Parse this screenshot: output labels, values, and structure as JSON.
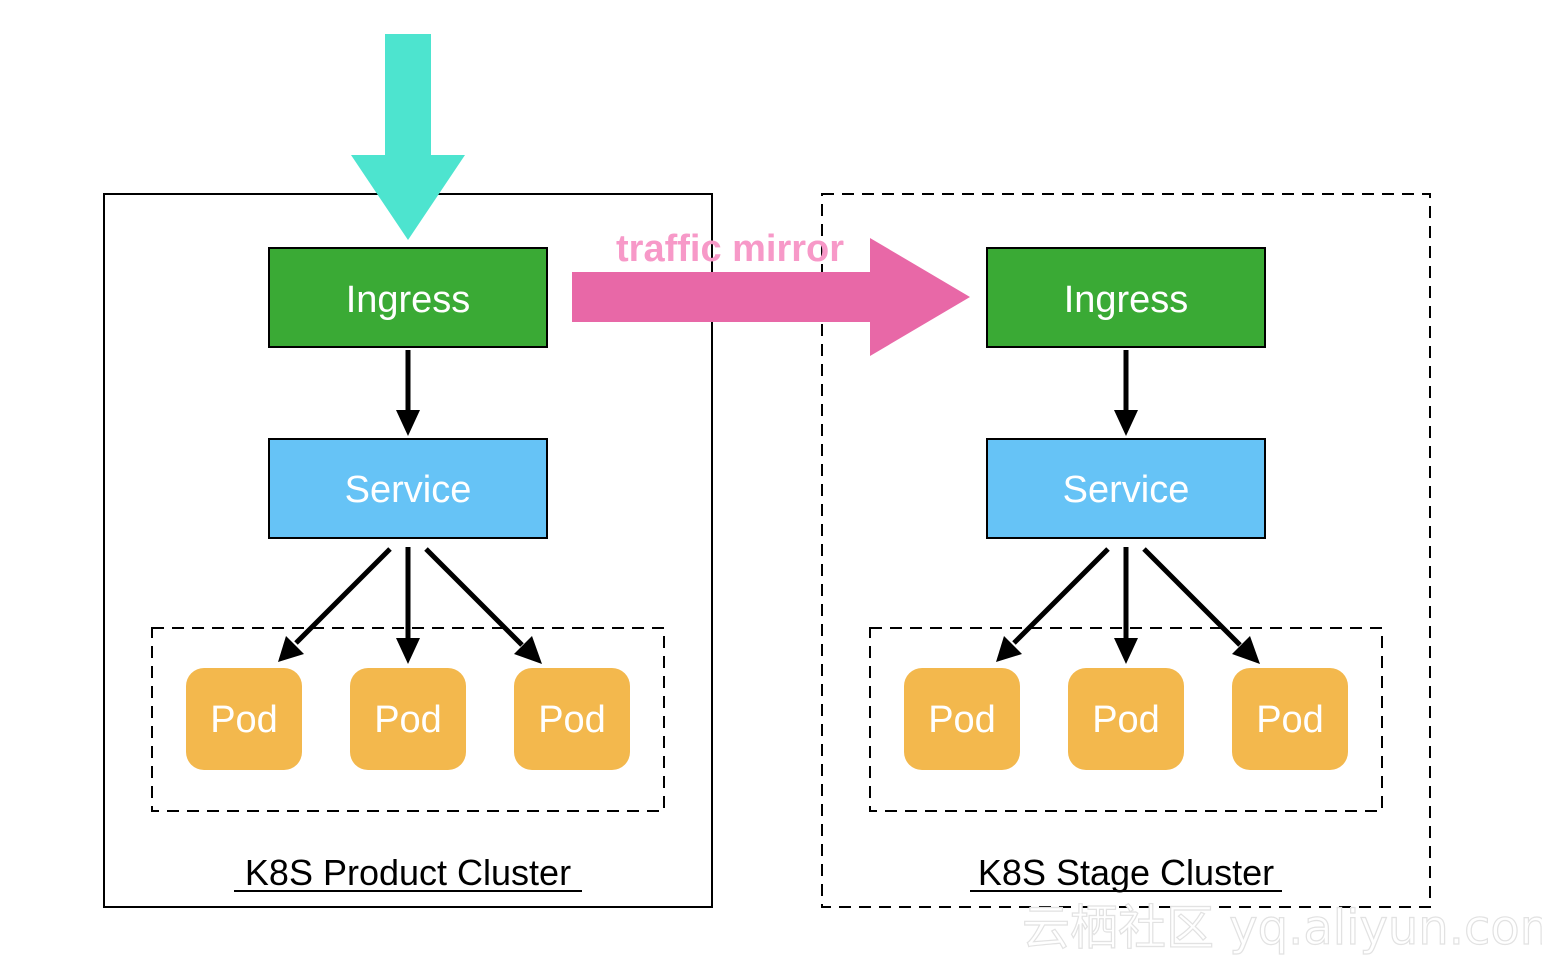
{
  "colors": {
    "ingress": "#3aaa35",
    "service": "#66c3f6",
    "pod": "#f3b84d",
    "mirror_arrow": "#e868a7",
    "mirror_text": "#f799c8",
    "entry_arrow": "#4de4cf",
    "line": "#000000"
  },
  "icons": {
    "entry_arrow": "down-arrow-icon",
    "mirror_arrow": "right-arrow-icon"
  },
  "mirror": {
    "label": "traffic mirror"
  },
  "clusters": [
    {
      "name": "K8S Product Cluster",
      "border": "solid",
      "ingress": "Ingress",
      "service": "Service",
      "pods": [
        "Pod",
        "Pod",
        "Pod"
      ]
    },
    {
      "name": "K8S Stage Cluster",
      "border": "dashed",
      "ingress": "Ingress",
      "service": "Service",
      "pods": [
        "Pod",
        "Pod",
        "Pod"
      ]
    }
  ],
  "watermark": "云栖社区 yq.aliyun.com"
}
